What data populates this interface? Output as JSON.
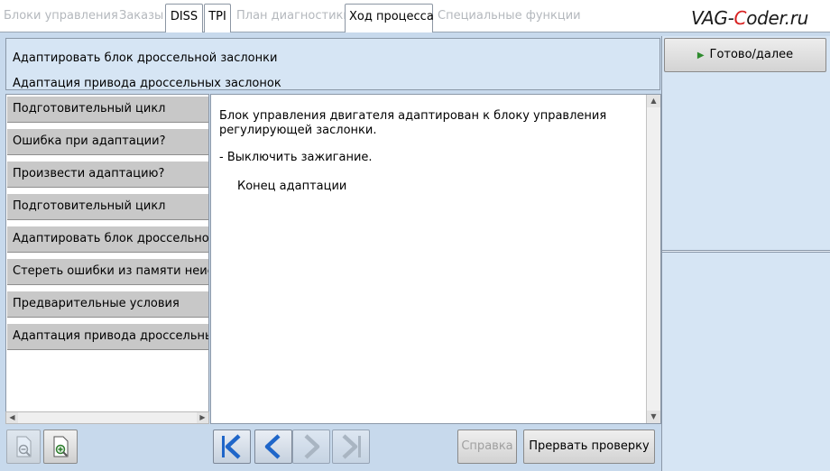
{
  "tabs": [
    {
      "label": "Блоки управления",
      "active": false
    },
    {
      "label": "Заказы",
      "active": false
    },
    {
      "label": "DISS",
      "active": true
    },
    {
      "label": "TPI",
      "active": true
    },
    {
      "label": "План диагностики",
      "active": false
    },
    {
      "label": "Ход процесса",
      "active": true
    },
    {
      "label": "Специальные функции",
      "active": false
    }
  ],
  "brand": {
    "prefix": "VAG-",
    "accent": "C",
    "suffix": "oder.ru"
  },
  "header": {
    "title": "Адаптировать блок дроссельной заслонки",
    "subtitle": "Адаптация привода дроссельных заслонок"
  },
  "steps": [
    "Подготовительный цикл",
    "Ошибка при адаптации?",
    "Произвести адаптацию?",
    "Подготовительный цикл",
    "Адаптировать блок дроссельной заслонки",
    "Стереть ошибки из памяти неисправностей",
    "Предварительные условия",
    "Адаптация привода дроссельных заслонок"
  ],
  "content": {
    "line1": "Блок управления двигателя адаптирован к блоку управления регулирующей заслонки.",
    "line2": "- Выключить зажигание.",
    "line3": "Конец адаптации"
  },
  "actions": {
    "ready": "Готово/далее",
    "help": "Справка",
    "abort": "Прервать проверку"
  },
  "colors": {
    "panel": "#c7d9ec",
    "accent": "#1f66c9",
    "brand_red": "#d82222"
  }
}
